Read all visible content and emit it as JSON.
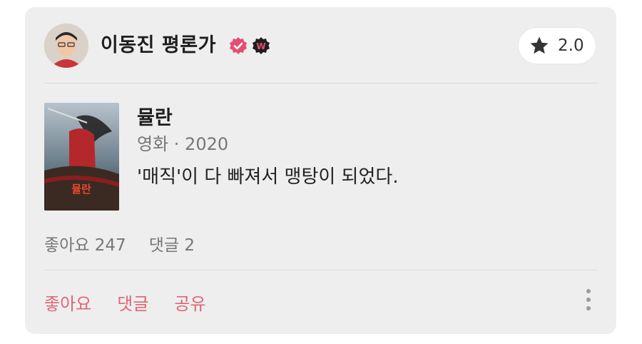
{
  "author": {
    "name": "이동진 평론가",
    "badge_letter": "W"
  },
  "rating": {
    "value": "2.0"
  },
  "movie": {
    "title": "뮬란",
    "meta": "영화 · 2020",
    "comment": "'매직'이 다 빠져서 맹탕이 되었다.",
    "poster_text": "뮬란"
  },
  "stats": {
    "likes": "좋아요 247",
    "comments": "댓글 2"
  },
  "actions": {
    "like": "좋아요",
    "comment": "댓글",
    "share": "공유"
  },
  "colors": {
    "accent": "#e06676",
    "verified": "#e64d73",
    "card_bg": "#eeeeee"
  }
}
